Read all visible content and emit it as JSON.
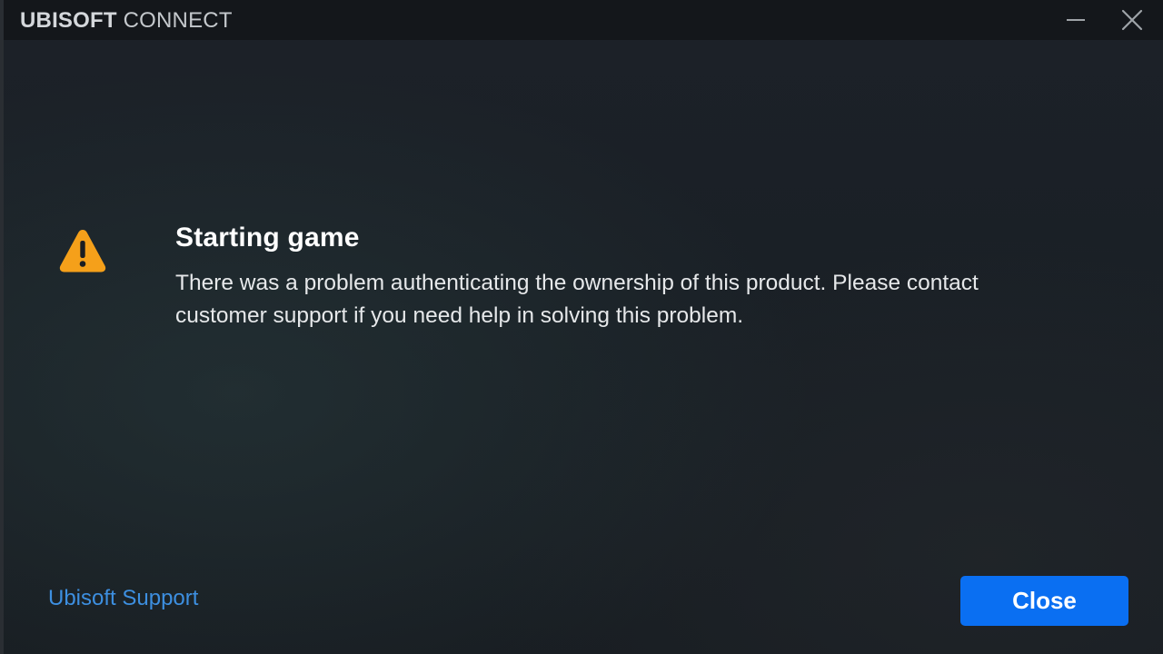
{
  "window": {
    "brand_strong": "UBISOFT",
    "brand_light": "CONNECT",
    "minimize_icon": "minimize-icon",
    "close_icon": "close-icon"
  },
  "dialog": {
    "icon": "warning-icon",
    "icon_color": "#f5a01a",
    "title": "Starting game",
    "message": "There was a problem authenticating the ownership of this product. Please contact customer support if you need help in solving this problem.",
    "support_link": "Ubisoft Support",
    "close_button": "Close",
    "accent_color": "#0a6ff2",
    "link_color": "#3d8fe0"
  }
}
